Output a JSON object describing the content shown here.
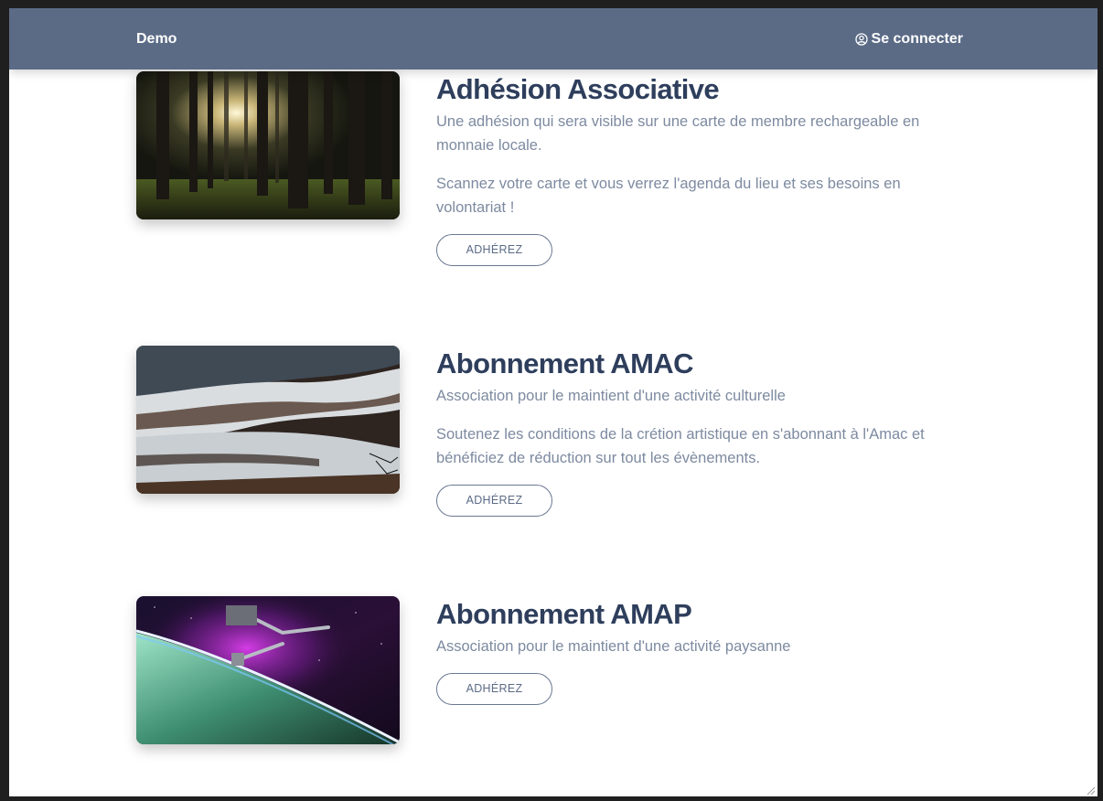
{
  "navbar": {
    "brand": "Demo",
    "login_label": "Se connecter",
    "login_icon": "user-circle-icon",
    "background": "#5b6b86"
  },
  "offers": [
    {
      "title": "Adhésion Associative",
      "descriptions": [
        "Une adhésion qui sera visible sur une carte de membre rechargeable en monnaie locale.",
        "Scannez votre carte et vous verrez l'agenda du lieu et ses besoins en volontariat !"
      ],
      "button_label": "ADHÉREZ",
      "image": "forest-image"
    },
    {
      "title": "Abonnement AMAC",
      "descriptions": [
        "Association pour le maintient d'une activité culturelle",
        "Soutenez les conditions de la crétion artistique en s'abonnant à l'Amac et bénéficiez de réduction sur tout les évènements."
      ],
      "button_label": "ADHÉREZ",
      "image": "ocean-waves-image"
    },
    {
      "title": "Abonnement AMAP",
      "descriptions": [
        "Association pour le maintient d'une activité paysanne"
      ],
      "button_label": "ADHÉREZ",
      "image": "space-aurora-image"
    }
  ],
  "colors": {
    "title": "#2e3e5c",
    "text": "#7d8aa0",
    "button_border": "#6a7892"
  }
}
